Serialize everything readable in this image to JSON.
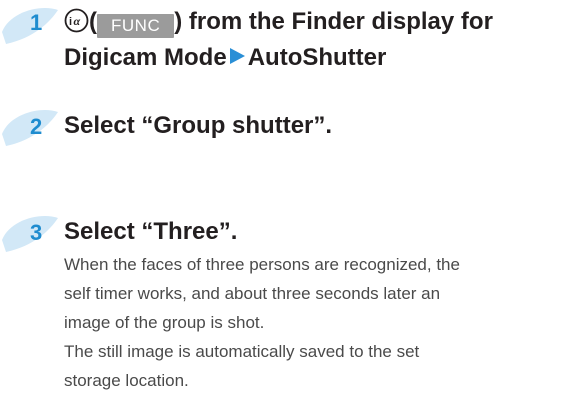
{
  "steps": [
    {
      "number": "1",
      "key_icon": "i-alpha-key-icon",
      "paren_open": "(",
      "func_label": "FUNC",
      "line1_after": ") from the Finder display for",
      "line2_a": "Digicam Mode",
      "arrow_icon": "right-triangle-icon",
      "line2_b": "AutoShutter"
    },
    {
      "number": "2",
      "title": "Select “Group shutter”."
    },
    {
      "number": "3",
      "title": "Select “Three”.",
      "desc_lines": [
        "When the faces of three persons are recognized, the",
        "self timer works, and about three seconds later an",
        "image of the group is shot.",
        "The still image is automatically saved to the set",
        "storage location."
      ]
    }
  ],
  "colors": {
    "badge": "#c8e3f5",
    "number": "#1f8ccf",
    "arrow": "#2a8fd6",
    "func_bg": "#9b9b9b"
  }
}
